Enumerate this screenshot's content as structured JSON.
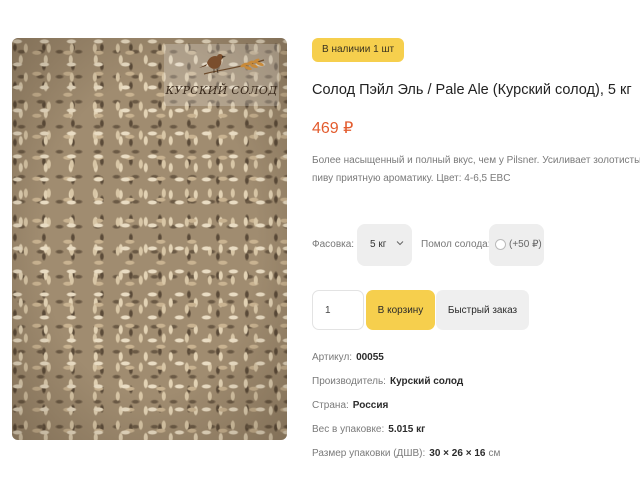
{
  "image": {
    "alt": "",
    "logo_text": "КУРСКИЙ СОЛОД"
  },
  "product": {
    "stock_badge": "В наличии 1 шт",
    "title": "Солод Пэйл Эль / Pale Ale (Курский солод), 5 кг",
    "price": "469 ₽",
    "description_line1": "Более насыщенный и полный вкус, чем у Pilsner. Усиливает золотистый ц",
    "description_line2": "пиву приятную ароматику. Цвет: 4-6,5 EBC"
  },
  "options": {
    "pack_label": "Фасовка:",
    "pack_value": "5 кг",
    "grind_label": "Помол солода:",
    "grind_price": "(+50 ₽)"
  },
  "purchase": {
    "quantity": "1",
    "cart_button": "В корзину",
    "quick_order_button": "Быстрый заказ"
  },
  "specs": [
    {
      "key": "Артикул:",
      "value": "00055",
      "unit": ""
    },
    {
      "key": "Производитель:",
      "value": "Курский солод",
      "unit": ""
    },
    {
      "key": "Страна:",
      "value": "Россия",
      "unit": ""
    },
    {
      "key": "Вес в упаковке:",
      "value": "5.015 кг",
      "unit": ""
    },
    {
      "key": "Размер упаковки (ДШВ):",
      "value": "30 × 26 × 16",
      "unit": "см"
    }
  ],
  "colors": {
    "accent_yellow": "#f6cf4d",
    "price_orange": "#e35b2d",
    "muted_gray": "#eeeeee"
  }
}
